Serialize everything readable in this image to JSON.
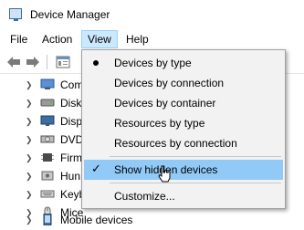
{
  "window": {
    "title": "Device Manager",
    "icon": "device-manager-icon"
  },
  "menubar": {
    "items": [
      "File",
      "Action",
      "View",
      "Help"
    ],
    "active": "View"
  },
  "toolbar": {
    "buttons": [
      "back-arrow-icon",
      "forward-arrow-icon",
      "properties-icon"
    ]
  },
  "tree": {
    "rows": [
      {
        "label": "Com",
        "icon": "computer-icon"
      },
      {
        "label": "Disk",
        "icon": "disk-drive-icon"
      },
      {
        "label": "Disp",
        "icon": "display-adapter-icon"
      },
      {
        "label": "DVD",
        "icon": "dvd-drive-icon"
      },
      {
        "label": "Firm",
        "icon": "firmware-icon"
      },
      {
        "label": "Hun",
        "icon": "hid-icon"
      },
      {
        "label": "Keyb",
        "icon": "keyboard-icon"
      },
      {
        "label": "Mice",
        "icon": "mouse-icon"
      },
      {
        "label": "Mobile devices",
        "icon": "mobile-device-icon"
      }
    ]
  },
  "view_menu": {
    "items": [
      {
        "label": "Devices by type",
        "marker": "bullet"
      },
      {
        "label": "Devices by connection"
      },
      {
        "label": "Devices by container"
      },
      {
        "label": "Resources by type"
      },
      {
        "label": "Resources by connection"
      },
      {
        "label": "Show hidden devices",
        "marker": "check",
        "hovered": true
      },
      {
        "label": "Customize..."
      }
    ]
  },
  "colors": {
    "menu_hover": "#91c9f7",
    "menu_active": "#cce8ff",
    "menu_bg": "#f2f2f2"
  }
}
